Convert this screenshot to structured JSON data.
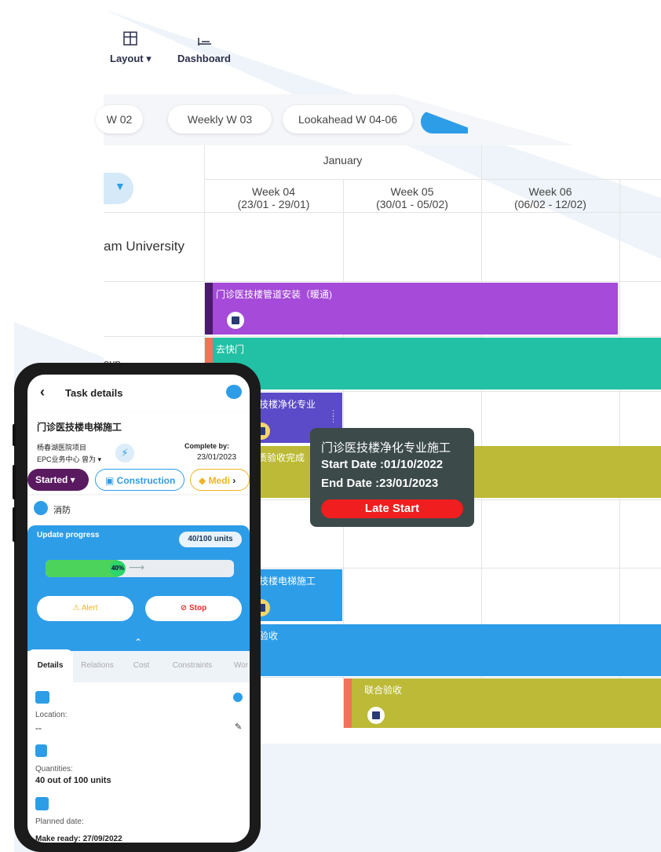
{
  "toolbar": {
    "layout_label": "Layout",
    "dashboard_label": "Dashboard"
  },
  "weeks_nav": {
    "chip1": "W 02",
    "chip2": "Weekly  W 03",
    "chip3": "Lookahead  W 04-06"
  },
  "grid": {
    "month": "January",
    "weeks": [
      {
        "name": "Week 04",
        "range": "(23/01 - 29/01)"
      },
      {
        "name": "Week 05",
        "range": "(30/01 - 05/02)"
      },
      {
        "name": "Week 06",
        "range": "(06/02 - 12/02)"
      }
    ],
    "row_label": "am University",
    "row_label_partial": "oup"
  },
  "bars": {
    "b1": "门诊医技楼管道安装（暖通)",
    "b2": "去快门",
    "b3": "技楼净化专业",
    "b4": "质验收完成",
    "b5": "技楼电梯施工",
    "b6": "验收",
    "b7": "联合验收"
  },
  "colors": {
    "purple": "#a54ad9",
    "teal": "#22c0a4",
    "indigo": "#5b4bc8",
    "olive": "#bcba36",
    "blue": "#2d9de8",
    "salmon": "#f0735a",
    "late_red": "#f01e1e"
  },
  "tooltip": {
    "title": "门诊医技楼净化专业施工",
    "start": "Start Date :01/10/2022",
    "end": "End Date :23/01/2023",
    "status": "Late Start"
  },
  "phone": {
    "header_title": "Task details",
    "task_name": "门诊医技楼电梯施工",
    "project": "杨春湖医院项目",
    "org": "EPC业务中心 曾为",
    "complete_by_label": "Complete by:",
    "complete_by_date": "23/01/2023",
    "status_pill": "Started",
    "category_pill": "Construction",
    "priority_pill": "Medi",
    "trade": "消防",
    "update_progress_label": "Update progress",
    "units_badge": "40/100 units",
    "progress_pct_text": "40%",
    "progress_value": 0.4,
    "alert_button": "Alert",
    "stop_button": "Stop",
    "tabs": [
      "Details",
      "Relations",
      "Cost",
      "Constraints",
      "Wor"
    ],
    "location_label": "Location:",
    "location_value": "--",
    "quantities_label": "Quantities:",
    "quantities_value": "40 out of 100 units",
    "planned_date_label": "Planned date:",
    "make_ready": "Make ready: 27/09/2022"
  },
  "icons": [
    "layout-icon",
    "dashboard-icon",
    "chevron-down-icon",
    "back-arrow-icon",
    "chat-icon",
    "lightning-icon",
    "wrench-icon",
    "building-icon",
    "bell-alert-icon",
    "stop-icon",
    "map-pin-icon",
    "info-icon",
    "edit-pencil-icon",
    "database-icon",
    "calendar-icon"
  ]
}
